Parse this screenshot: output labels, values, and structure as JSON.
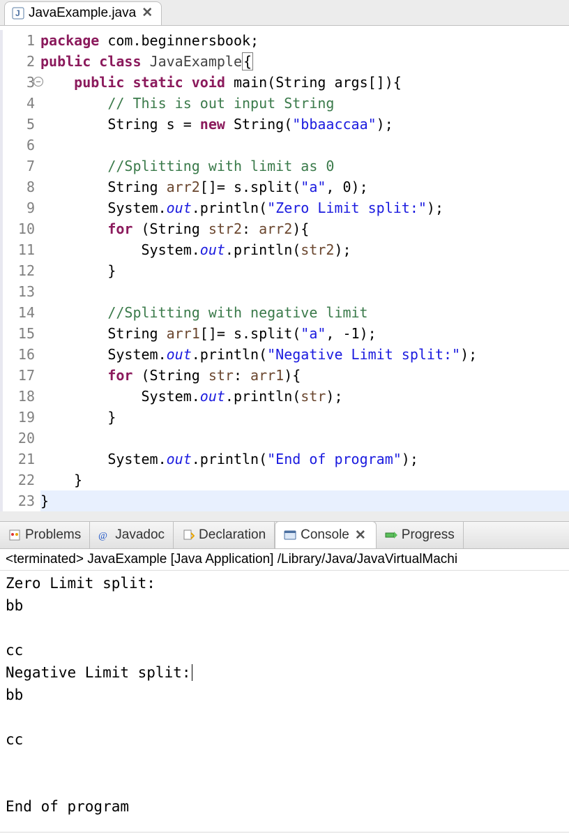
{
  "editor": {
    "tab_title": "JavaExample.java",
    "lines": [
      {
        "n": "1",
        "html": "<span class='kw'>package</span> <span class='plain'>com.beginnersbook;</span>"
      },
      {
        "n": "2",
        "html": "<span class='kw'>public</span> <span class='kw'>class</span> <span class='cls'>JavaExample</span><span class='box-brace'>{</span>"
      },
      {
        "n": "3",
        "html": "    <span class='kw'>public</span> <span class='kw'>static</span> <span class='kw'>void</span> <span class='plain'>main(String args[]){</span>",
        "collapse": true
      },
      {
        "n": "4",
        "html": "        <span class='cm'>// This is out input String</span>"
      },
      {
        "n": "5",
        "html": "        <span class='plain'>String s = </span><span class='kw'>new</span> <span class='plain'>String(</span><span class='str'>\"bbaaccaa\"</span><span class='plain'>);</span>"
      },
      {
        "n": "6",
        "html": ""
      },
      {
        "n": "7",
        "html": "        <span class='cm'>//Splitting with limit as 0</span>"
      },
      {
        "n": "8",
        "html": "        <span class='plain'>String </span><span class='var'>arr2</span><span class='plain'>[]= s.split(</span><span class='str'>\"a\"</span><span class='plain'>, 0);</span>"
      },
      {
        "n": "9",
        "html": "        <span class='plain'>System.</span><span class='field'>out</span><span class='plain'>.println(</span><span class='str'>\"Zero Limit split:\"</span><span class='plain'>);</span>"
      },
      {
        "n": "10",
        "html": "        <span class='kw'>for</span> <span class='plain'>(String </span><span class='var'>str2</span><span class='plain'>: </span><span class='var'>arr2</span><span class='plain'>){</span>"
      },
      {
        "n": "11",
        "html": "            <span class='plain'>System.</span><span class='field'>out</span><span class='plain'>.println(</span><span class='var'>str2</span><span class='plain'>);</span>"
      },
      {
        "n": "12",
        "html": "        <span class='plain'>}</span>"
      },
      {
        "n": "13",
        "html": ""
      },
      {
        "n": "14",
        "html": "        <span class='cm'>//Splitting with negative limit</span>"
      },
      {
        "n": "15",
        "html": "        <span class='plain'>String </span><span class='var'>arr1</span><span class='plain'>[]= s.split(</span><span class='str'>\"a\"</span><span class='plain'>, -1);</span>"
      },
      {
        "n": "16",
        "html": "        <span class='plain'>System.</span><span class='field'>out</span><span class='plain'>.println(</span><span class='str'>\"Negative Limit split:\"</span><span class='plain'>);</span>"
      },
      {
        "n": "17",
        "html": "        <span class='kw'>for</span> <span class='plain'>(String </span><span class='var'>str</span><span class='plain'>: </span><span class='var'>arr1</span><span class='plain'>){</span>"
      },
      {
        "n": "18",
        "html": "            <span class='plain'>System.</span><span class='field'>out</span><span class='plain'>.println(</span><span class='var'>str</span><span class='plain'>);</span>"
      },
      {
        "n": "19",
        "html": "        <span class='plain'>}</span>"
      },
      {
        "n": "20",
        "html": ""
      },
      {
        "n": "21",
        "html": "        <span class='plain'>System.</span><span class='field'>out</span><span class='plain'>.println(</span><span class='str'>\"End of program\"</span><span class='plain'>);</span>"
      },
      {
        "n": "22",
        "html": "    <span class='plain'>}</span>"
      },
      {
        "n": "23",
        "html": "<span class='hl-line'><span class='plain'>}</span></span>"
      }
    ]
  },
  "bottom_tabs": {
    "problems": "Problems",
    "javadoc": "Javadoc",
    "declaration": "Declaration",
    "console": "Console",
    "progress": "Progress"
  },
  "console": {
    "header": "<terminated> JavaExample [Java Application] /Library/Java/JavaVirtualMachi",
    "output": "Zero Limit split:\nbb\n\ncc\nNegative Limit split:\nbb\n\ncc\n\n\nEnd of program"
  }
}
